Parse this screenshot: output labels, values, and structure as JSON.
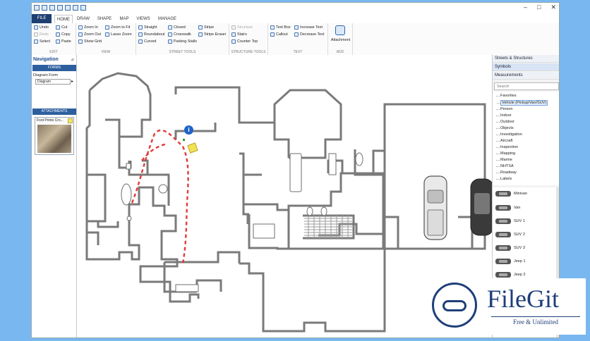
{
  "tabs": [
    "FILE",
    "HOME",
    "DRAW",
    "SHAPE",
    "MAP",
    "VIEWS",
    "MANAGE"
  ],
  "ribbon": {
    "edit": {
      "label": "EDIT",
      "items": [
        "Undo",
        "Redo",
        "Select",
        "Cut",
        "Copy",
        "Paste"
      ]
    },
    "view": {
      "label": "VIEW",
      "items": [
        "Zoom In",
        "Zoom Out",
        "Show Grid",
        "Zoom to Fit",
        "Lasso Zoom"
      ]
    },
    "street": {
      "label": "STREET TOOLS",
      "items": [
        "Straight",
        "Roundabout",
        "Curved",
        "Closed",
        "Crosswalk",
        "Parking Stalls",
        "Stripe",
        "Stripe Eraser"
      ]
    },
    "structure": {
      "label": "STRUCTURE TOOLS",
      "items": [
        "Structure",
        "Stairs",
        "Counter Top"
      ]
    },
    "text": {
      "label": "TEXT",
      "items": [
        "Text Box",
        "Callout",
        "Increase Text",
        "Decrease Text"
      ]
    },
    "add": {
      "label": "ADD",
      "items": [
        "Attachment"
      ]
    }
  },
  "nav": {
    "title": "Navigation",
    "forms_label": "FORMS",
    "diagram_form": "Diagram Form",
    "diagram_value": "Diagram",
    "attachments_label": "ATTACHMENTS",
    "attachment_name": "Foot Prints Cro..."
  },
  "right": {
    "streets": "Streets & Structures",
    "symbols": "Symbols",
    "measurements": "Measurements",
    "search_placeholder": "Search",
    "tree": [
      "Favorites",
      "Vehicle (Pickup/Van/SUV)",
      "Person",
      "Indoor",
      "Outdoor",
      "Objects",
      "Investigation",
      "Aircraft",
      "Inspection",
      "Mapping",
      "Marine",
      "NHTSA",
      "Roadway",
      "Labels"
    ],
    "symbols_list": [
      "Minivan",
      "Van",
      "SUV 1",
      "SUV 2",
      "SUV 3",
      "Jeep 1",
      "Jeep 2"
    ]
  },
  "watermark": {
    "title": "FileGit",
    "subtitle": "Free & Unlimited"
  }
}
